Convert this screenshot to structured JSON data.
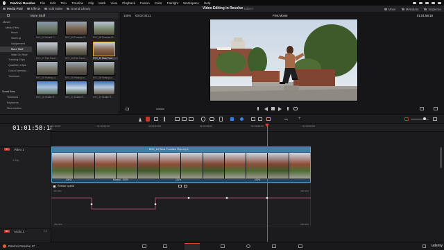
{
  "menubar": {
    "app_name": "DaVinci Resolve",
    "items": [
      "File",
      "Edit",
      "Trim",
      "Timeline",
      "Clip",
      "Mark",
      "View",
      "Playback",
      "Fusion",
      "Color",
      "Fairlight",
      "Workspace",
      "Help"
    ]
  },
  "toolbar": {
    "media_pool": "Media Pool",
    "effects": "Effects",
    "edit_index": "Edit Index",
    "sound_library": "Sound Library",
    "project_title": "Video Editing in Resolve",
    "project_status": "Edited",
    "mixer": "Mixer",
    "metadata": "Metadata",
    "inspector": "Inspector"
  },
  "media_pool": {
    "current_bin": "More Stuff",
    "tree": [
      "Master",
      "Media Files",
      "Music",
      "Start Up",
      "Assignment",
      "More Stuff",
      "Walk On Roof",
      "Tracking Clips",
      "Qualifiers Clips",
      "Color Correctio...",
      "Timelines"
    ],
    "selected_tree_index": 5,
    "smart_bins_title": "Smart Bins",
    "smart_bins": [
      "Timelines",
      "Keywords",
      "Slow motion"
    ],
    "clips": [
      "NYC_01 Around T...",
      "NYC_09 Fountain S...",
      "NYC_08 Fountain 01...",
      "NYC_07 Fish Fount...",
      "NYC_08 Fish Fount...",
      "NYC_12 Slow Foun...",
      "NYC_04 Parking Lo...",
      "NYC_05 Parking Lo...",
      "NYC_06 Parking Lo...",
      "NYC_10 Seattle R...",
      "NYC_11 Seattle R...",
      "NYC_13 Seattle R..."
    ],
    "selected_clip_index": 5
  },
  "viewer": {
    "zoom": "105%",
    "source_timecode": "00:02:00:11",
    "timeline_name": "First Movie",
    "record_timecode": "01:01:58:18"
  },
  "timeline": {
    "current_timecode": "01:01:58:18",
    "ruler_ticks": [
      "01:00:00",
      "01:01:52:00",
      "01:01:54:00",
      "01:01:56:00",
      "01:01:58:00",
      "01:02:00:00"
    ],
    "video_track_label": "V1",
    "video_track_name": "Video 1",
    "video_track_info": "1 Clip",
    "clip_name": "BG2_12 Slow Fountain Flips.mp4",
    "speed_labels": [
      "100%",
      "Rewind - 100%",
      "100%",
      "100%"
    ],
    "retime_title": "Retime Speed",
    "curve_labels_left_top": "300.00%",
    "curve_labels_left_bottom": "-300.00%",
    "curve_labels_right_top": "300.00%",
    "curve_labels_right_bottom": "-300.00%",
    "audio_track_label": "A1",
    "audio_track_name": "Audio 1",
    "audio_track_value": "2.0"
  },
  "footer": {
    "app_version": "DaVinci Resolve 17",
    "watermark": "udemy"
  },
  "colors": {
    "playhead": "#e3412f",
    "clip_header": "#3f7fa5",
    "clip_body": "#2b5f80",
    "selection": "#d9a441"
  }
}
